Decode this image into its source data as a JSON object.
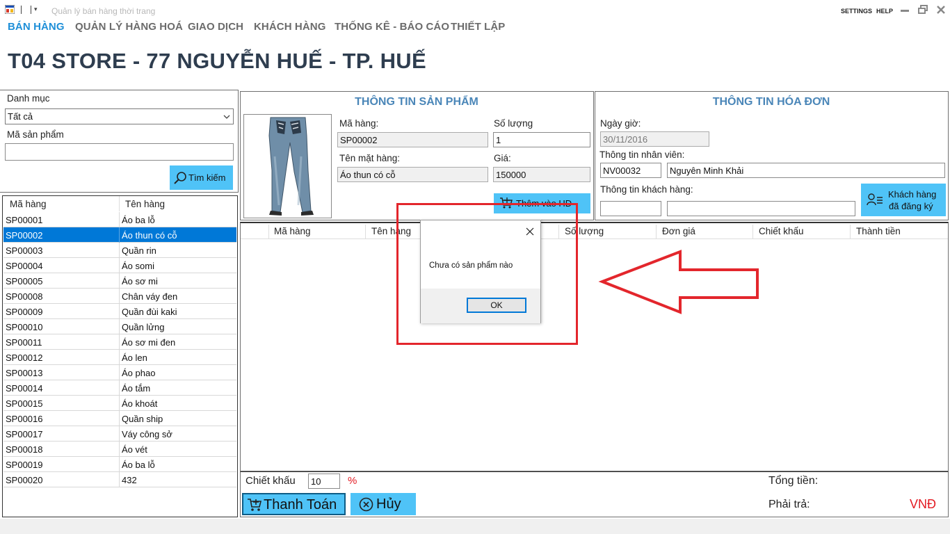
{
  "window": {
    "title": "Quản lý bán hàng thời trang",
    "settings": "SETTINGS",
    "help": "HELP"
  },
  "menu": [
    "BÁN HÀNG",
    "QUẢN LÝ HÀNG HOÁ",
    "GIAO DỊCH",
    "KHÁCH HÀNG",
    "THỐNG KÊ - BÁO CÁO",
    "THIẾT LẬP"
  ],
  "store_title": "T04 STORE - 77 NGUYỄN HUẾ - TP. HUẾ",
  "filter": {
    "category_label": "Danh mục",
    "category_value": "Tất cả",
    "code_label": "Mã sản phẩm",
    "code_value": "",
    "search_button": "Tìm kiếm"
  },
  "product_list": {
    "headers": [
      "Mã hàng",
      "Tên hàng"
    ],
    "rows": [
      [
        "SP00001",
        "Áo ba lỗ"
      ],
      [
        "SP00002",
        "Áo thun có cỗ"
      ],
      [
        "SP00003",
        "Quần rin"
      ],
      [
        "SP00004",
        "Áo somi"
      ],
      [
        "SP00005",
        "Áo sơ mi"
      ],
      [
        "SP00008",
        "Chân váy đen"
      ],
      [
        "SP00009",
        "Quần đùi kaki"
      ],
      [
        "SP00010",
        "Quần lửng"
      ],
      [
        "SP00011",
        "Áo sơ mi đen"
      ],
      [
        "SP00012",
        "Áo len"
      ],
      [
        "SP00013",
        "Áo phao"
      ],
      [
        "SP00014",
        "Áo tắm"
      ],
      [
        "SP00015",
        "Áo khoát"
      ],
      [
        "SP00016",
        "Quần ship"
      ],
      [
        "SP00017",
        "Váy công sở"
      ],
      [
        "SP00018",
        "Áo vét"
      ],
      [
        "SP00019",
        "Áo ba lỗ"
      ],
      [
        "SP00020",
        "432"
      ]
    ],
    "selected_index": 1
  },
  "product_info": {
    "heading": "THÔNG TIN SẢN PHẨM",
    "code_label": "Mã hàng:",
    "code_value": "SP00002",
    "qty_label": "Số lượng",
    "qty_value": "1",
    "name_label": "Tên mặt hàng:",
    "name_value": "Áo thun có cỗ",
    "price_label": "Giá:",
    "price_value": "150000",
    "add_button": "Thêm vào HĐ"
  },
  "invoice_info": {
    "heading": "THÔNG TIN HÓA ĐƠN",
    "date_label": "Ngày giờ:",
    "date_value": "30/11/2016",
    "staff_label": "Thông tin nhân viên:",
    "staff_id": "NV00032",
    "staff_name": "Nguyên Minh Khải",
    "customer_label": "Thông tin khách hàng:",
    "customer_id": "",
    "customer_name": "",
    "registered_button_line1": "Khách hàng",
    "registered_button_line2": "đã đăng ký"
  },
  "invoice_grid": {
    "headers": [
      "Mã hàng",
      "Tên hàng",
      "Số lượng",
      "Đơn giá",
      "Chiết khấu",
      "Thành tiền"
    ]
  },
  "footer": {
    "discount_label": "Chiết khấu",
    "discount_value": "10",
    "percent": "%",
    "pay_button": "Thanh Toán",
    "cancel_button": "Hủy",
    "total_label": "Tổng tiền:",
    "payable_label": "Phải trả:",
    "currency": "VNĐ"
  },
  "dialog": {
    "message": "Chưa có sản phẩm nào",
    "ok": "OK"
  },
  "colors": {
    "accent": "#1e8fd8",
    "button_blue": "#4fc3f7",
    "selection": "#0078d7",
    "annotation_red": "#e3262c",
    "heading_blue": "#4a86b8",
    "currency_red": "#e31b23"
  }
}
